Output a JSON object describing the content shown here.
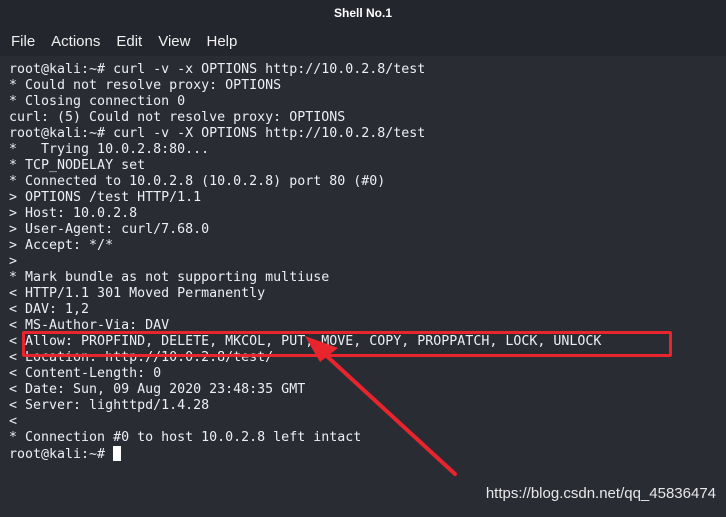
{
  "window": {
    "title": "Shell No.1"
  },
  "menu": [
    "File",
    "Actions",
    "Edit",
    "View",
    "Help"
  ],
  "terminal": {
    "lines": [
      "root@kali:~# curl -v -x OPTIONS http://10.0.2.8/test",
      "* Could not resolve proxy: OPTIONS",
      "* Closing connection 0",
      "curl: (5) Could not resolve proxy: OPTIONS",
      "root@kali:~# curl -v -X OPTIONS http://10.0.2.8/test",
      "*   Trying 10.0.2.8:80...",
      "* TCP_NODELAY set",
      "* Connected to 10.0.2.8 (10.0.2.8) port 80 (#0)",
      "> OPTIONS /test HTTP/1.1",
      "> Host: 10.0.2.8",
      "> User-Agent: curl/7.68.0",
      "> Accept: */*",
      ">",
      "* Mark bundle as not supporting multiuse",
      "< HTTP/1.1 301 Moved Permanently",
      "< DAV: 1,2",
      "< MS-Author-Via: DAV",
      "< Allow: PROPFIND, DELETE, MKCOL, PUT, MOVE, COPY, PROPPATCH, LOCK, UNLOCK",
      "< Location: http://10.0.2.8/test/",
      "< Content-Length: 0",
      "< Date: Sun, 09 Aug 2020 23:48:35 GMT",
      "< Server: lighttpd/1.4.28",
      "<",
      "* Connection #0 to host 10.0.2.8 left intact"
    ],
    "prompt": "root@kali:~# "
  },
  "annotation": {
    "color": "#e8252c"
  },
  "watermark": "https://blog.csdn.net/qq_45836474"
}
